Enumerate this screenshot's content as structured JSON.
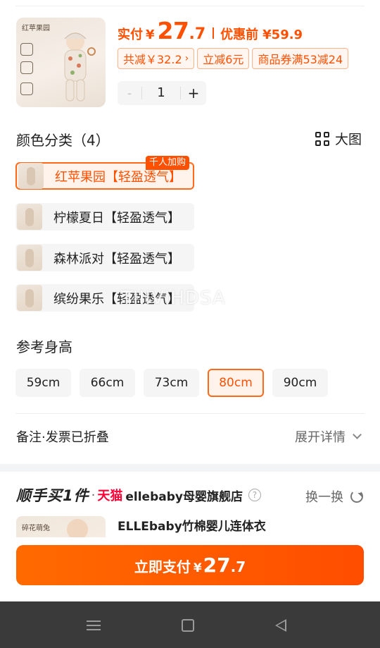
{
  "product": {
    "thumb_brand": "红苹果园",
    "price_label": "实付",
    "currency": "¥",
    "price_int": "27",
    "price_dec": ".7",
    "original_label": "优惠前",
    "original_price": "¥59.9",
    "chips": [
      {
        "label": "共减￥32.2",
        "arrow": "›"
      },
      {
        "label": "立减6元"
      },
      {
        "label": "商品券满53减24"
      }
    ],
    "quantity": "1",
    "minus": "-",
    "plus": "+"
  },
  "colors": {
    "title": "颜色分类（4）",
    "big_image_label": "大图",
    "hot_tag": "千人加购",
    "options": [
      {
        "name": "红苹果园【轻盈透气】",
        "selected": true
      },
      {
        "name": "柠檬夏日【轻盈透气】",
        "selected": false
      },
      {
        "name": "森林派对【轻盈透气】",
        "selected": false
      },
      {
        "name": "缤纷果乐【轻盈透气】",
        "selected": false
      }
    ]
  },
  "watermark": "TIIIVIHDSA",
  "sizes": {
    "title": "参考身高",
    "options": [
      {
        "label": "59cm",
        "selected": false
      },
      {
        "label": "66cm",
        "selected": false
      },
      {
        "label": "73cm",
        "selected": false
      },
      {
        "label": "80cm",
        "selected": true
      },
      {
        "label": "90cm",
        "selected": false
      }
    ]
  },
  "notes": {
    "label": "备注·发票已折叠",
    "expand_label": "展开详情"
  },
  "recommend": {
    "title": "顺手买1件",
    "separator": "·",
    "tmall": "天猫",
    "store": "ellebaby母婴旗舰店",
    "help": "?",
    "refresh_label": "换一换",
    "item_tag": "碎花萌兔",
    "item_name": "ELLEbaby竹棉婴儿连体衣"
  },
  "pay": {
    "label": "立即支付",
    "currency": "¥",
    "price_int": "27",
    "price_dec": ".7"
  },
  "colors_theme": {
    "accent": "#ff5000",
    "tmall_red": "#ff0036",
    "nav_bg": "#3a3a3a"
  }
}
